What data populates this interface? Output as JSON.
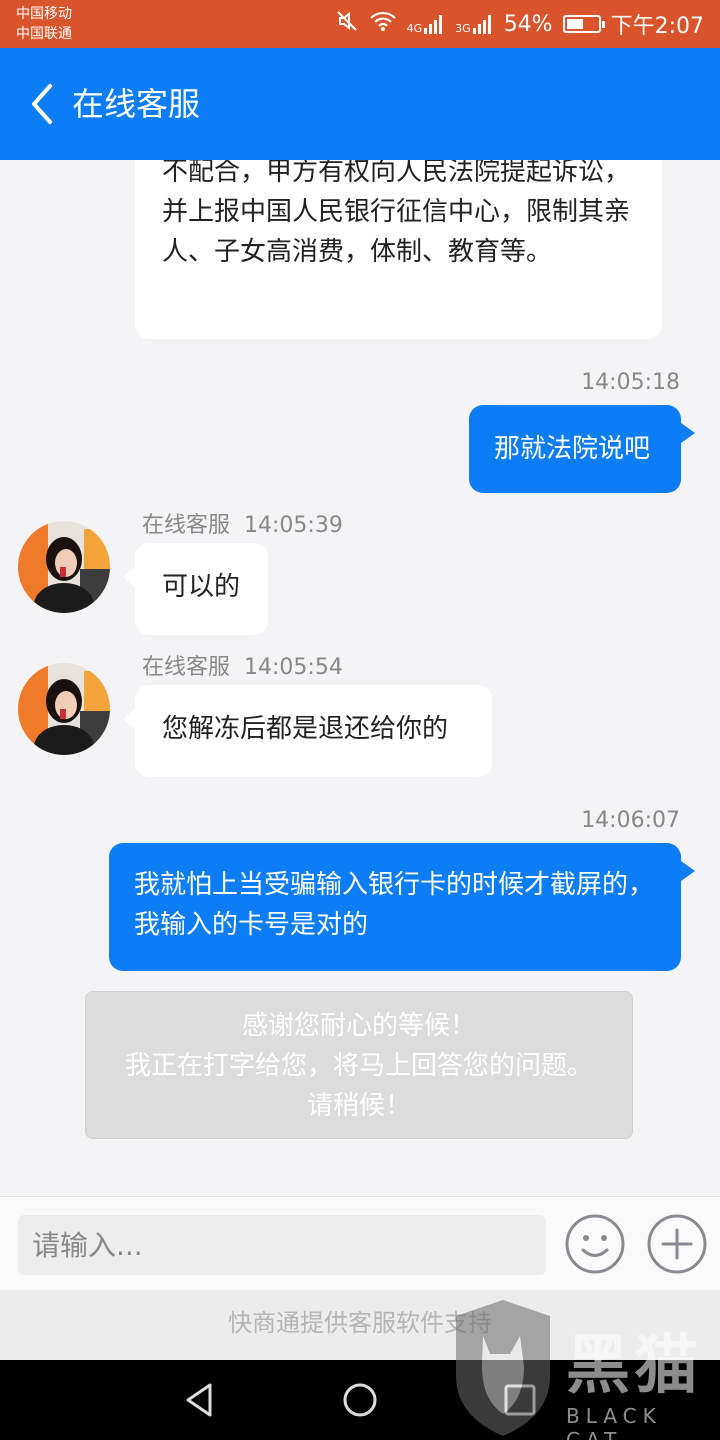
{
  "status_bar": {
    "carrier_1": "中国移动",
    "carrier_2": "中国联通",
    "network_1": "4G",
    "network_2": "3G",
    "battery": "54%",
    "battery_level": 0.54,
    "time": "下午2:07"
  },
  "header": {
    "title": "在线客服",
    "accent_color": "#0d7df5"
  },
  "messages": [
    {
      "from": "agent",
      "text": "不配合，甲方有权向人民法院提起诉讼，并上报中国人民银行征信中心，限制其亲人、子女高消费，体制、教育等。"
    },
    {
      "from": "user",
      "time": "14:05:18",
      "text": "那就法院说吧"
    },
    {
      "from": "agent",
      "sender": "在线客服",
      "time": "14:05:39",
      "text": "可以的"
    },
    {
      "from": "agent",
      "sender": "在线客服",
      "time": "14:05:54",
      "text": "您解冻后都是退还给你的"
    },
    {
      "from": "user",
      "time": "14:06:07",
      "text": "我就怕上当受骗输入银行卡的时候才截屏的，我输入的卡号是对的"
    }
  ],
  "waiting_notice": {
    "line1": "感谢您耐心的等候！",
    "line2": "我正在打字给您，将马上回答您的问题。",
    "line3": "请稍候！"
  },
  "input": {
    "placeholder": "请输入..."
  },
  "footer": {
    "note": "快商通提供客服软件支持"
  },
  "watermark": {
    "text": "黑猫",
    "sub": "BLACK CAT"
  }
}
